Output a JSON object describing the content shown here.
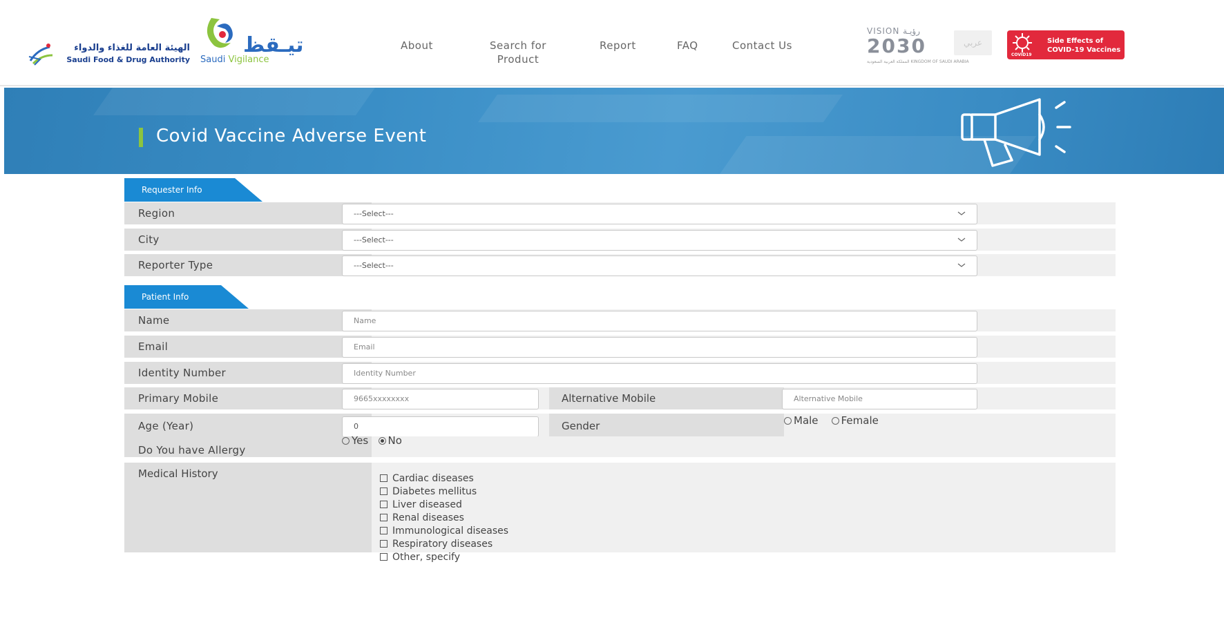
{
  "colors": {
    "brand_blue": "#2b6bbf",
    "brand_green": "#8cc43f",
    "banner_blue": "#3a8ec6",
    "tab_blue": "#1a8ad4",
    "covid_red": "#e2293c"
  },
  "header": {
    "sfda_arabic": "الهيئة العامة للغذاء والدواء",
    "sfda_english": "Saudi Food & Drug Authority",
    "vigilance_arabic": "تيـقظ",
    "vigilance_english_1": "Saudi",
    "vigilance_english_2": "Vigilance",
    "nav": [
      {
        "label": "About"
      },
      {
        "label_line1": "Search for",
        "label_line2": "Product"
      },
      {
        "label": "Report"
      },
      {
        "label": "FAQ"
      },
      {
        "label": "Contact Us"
      }
    ],
    "vision_top": "VISION رؤيـة",
    "vision_year": "2030",
    "vision_sub": "المملكة العربية السعودية KINGDOM OF SAUDI ARABIA",
    "language_button": "عربي",
    "covid_badge_line1": "Side Effects of",
    "covid_badge_line2": "COVID-19 Vaccines",
    "covid_badge_icon_label": "COVID19"
  },
  "banner": {
    "title": "Covid Vaccine Adverse Event",
    "icon": "megaphone-icon"
  },
  "form": {
    "requester_section": "Requester Info",
    "patient_section": "Patient Info",
    "region_label": "Region",
    "region_value": "---Select---",
    "city_label": "City",
    "city_value": "---Select---",
    "reporter_type_label": "Reporter Type",
    "reporter_type_value": "---Select---",
    "name_label": "Name",
    "name_placeholder": "Name",
    "email_label": "Email",
    "email_placeholder": "Email",
    "identity_label": "Identity Number",
    "identity_placeholder": "Identity Number",
    "primary_mobile_label": "Primary Mobile",
    "primary_mobile_placeholder": "9665xxxxxxxx",
    "alt_mobile_label": "Alternative Mobile",
    "alt_mobile_placeholder": "Alternative Mobile",
    "age_label": "Age (Year)",
    "age_value": "0",
    "gender_label": "Gender",
    "gender_male": "Male",
    "gender_female": "Female",
    "allergy_label": "Do You have Allergy",
    "allergy_yes": "Yes",
    "allergy_no": "No",
    "allergy_selected": "No",
    "medical_history_label": "Medical History",
    "medical_history_options": [
      "Cardiac diseases",
      "Diabetes mellitus",
      "Liver diseased",
      "Renal diseases",
      "Immunological diseases",
      "Respiratory diseases",
      "Other, specify"
    ]
  }
}
